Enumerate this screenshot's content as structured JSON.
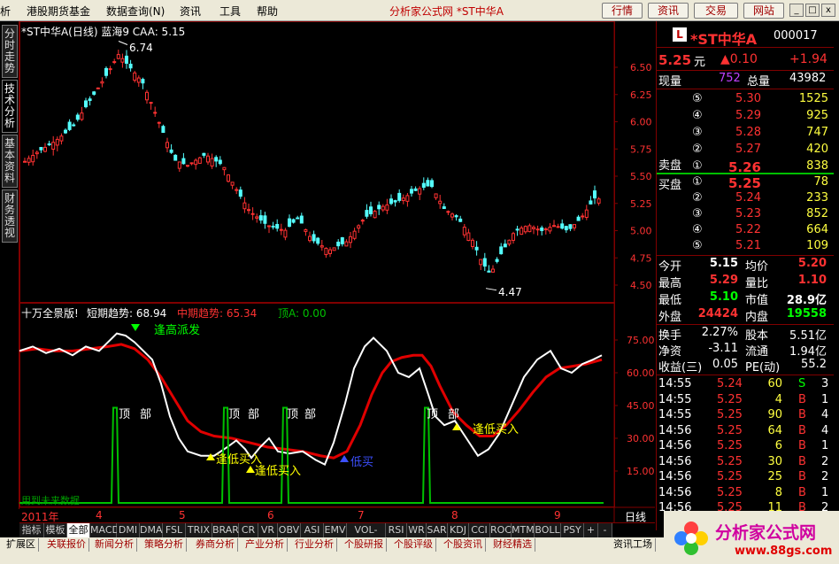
{
  "menu": {
    "items": [
      "析",
      "港股期货基金",
      "数据查询(N)",
      "资讯",
      "工具",
      "帮助"
    ],
    "center_title": "分析家公式网 *ST中华A",
    "right_buttons": [
      "行情",
      "资讯",
      "交易",
      "网站"
    ],
    "window_buttons": [
      "_",
      "□",
      "x"
    ]
  },
  "vtabs": [
    "分时走势",
    "技术分析",
    "基本资料",
    "财务透视"
  ],
  "main_chart": {
    "title": "*ST中华A(日线) 蓝海9 CAA: 5.15",
    "high_label": "6.74",
    "low_label": "4.47",
    "y_ticks": [
      "6.50",
      "6.25",
      "6.00",
      "5.75",
      "5.50",
      "5.25",
      "5.00",
      "4.75",
      "4.50"
    ]
  },
  "indicator": {
    "name": "十万全景版!",
    "short_label": "短期趋势: 68.94",
    "mid_label": "中期趋势: 65.34",
    "top_label": "顶A: 0.00",
    "y_ticks": [
      "75.00",
      "60.00",
      "45.00",
      "30.00",
      "15.00"
    ],
    "annotations": [
      "逢高派发",
      "逢低买入",
      "逢低买入",
      "低买",
      "逢低买入"
    ],
    "bottom_labels": [
      "顶",
      "部",
      "顶",
      "部",
      "顶",
      "部",
      "顶",
      "部"
    ],
    "footnote": "用到未来数据"
  },
  "time_axis": {
    "labels": [
      "2011年",
      "4",
      "5",
      "6",
      "7",
      "8",
      "9"
    ],
    "period": "日线"
  },
  "index_tabs": [
    "指标",
    "模板",
    "全部",
    "MACD",
    "DMI",
    "DMA",
    "FSL",
    "TRIX",
    "BRAR",
    "CR",
    "VR",
    "OBV",
    "ASI",
    "EMV",
    "VOL-TDX",
    "RSI",
    "WR",
    "SAR",
    "KDJ",
    "CCI",
    "ROC",
    "MTM",
    "BOLL",
    "PSY",
    "+",
    "-"
  ],
  "category_tabs": [
    "扩展区",
    "关联报价",
    "新闻分析",
    "策略分析",
    "券商分析",
    "产业分析",
    "行业分析",
    "个股研报",
    "个股评级",
    "个股资讯",
    "财经精选",
    "资讯工场"
  ],
  "quote": {
    "badge": "L",
    "name": "*ST中华A",
    "code": "000017",
    "price": "5.25",
    "price_unit": "元",
    "change": "▲0.10",
    "change_pct": "+1.94",
    "now_vol_label": "现量",
    "now_vol": "752",
    "total_vol_label": "总量",
    "total_vol": "43982",
    "sell_label": "卖盘",
    "buy_label": "买盘",
    "sells": [
      {
        "n": "⑤",
        "p": "5.30",
        "v": "1525"
      },
      {
        "n": "④",
        "p": "5.29",
        "v": "925"
      },
      {
        "n": "③",
        "p": "5.28",
        "v": "747"
      },
      {
        "n": "②",
        "p": "5.27",
        "v": "420"
      },
      {
        "n": "①",
        "p": "5.26",
        "v": "838"
      }
    ],
    "buys": [
      {
        "n": "①",
        "p": "5.25",
        "v": "78"
      },
      {
        "n": "②",
        "p": "5.24",
        "v": "233"
      },
      {
        "n": "③",
        "p": "5.23",
        "v": "852"
      },
      {
        "n": "④",
        "p": "5.22",
        "v": "664"
      },
      {
        "n": "⑤",
        "p": "5.21",
        "v": "109"
      }
    ],
    "stats": [
      {
        "l1": "今开",
        "v1": "5.15",
        "l2": "均价",
        "v2": "5.20"
      },
      {
        "l1": "最高",
        "v1": "5.29",
        "l2": "量比",
        "v2": "1.10"
      },
      {
        "l1": "最低",
        "v1": "5.10",
        "l2": "市值",
        "v2": "28.9亿"
      },
      {
        "l1": "外盘",
        "v1": "24424",
        "l2": "内盘",
        "v2": "19558"
      }
    ],
    "stats2": [
      {
        "l1": "换手",
        "v1": "2.27%",
        "l2": "股本",
        "v2": "5.51亿"
      },
      {
        "l1": "净资",
        "v1": "-3.11",
        "l2": "流通",
        "v2": "1.94亿"
      },
      {
        "l1": "收益(三)",
        "v1": "0.05",
        "l2": "PE(动)",
        "v2": "55.2"
      }
    ],
    "ticks": [
      {
        "t": "14:55",
        "p": "5.24",
        "v": "60",
        "s": "S",
        "n": "3"
      },
      {
        "t": "14:55",
        "p": "5.25",
        "v": "4",
        "s": "B",
        "n": "1"
      },
      {
        "t": "14:55",
        "p": "5.25",
        "v": "90",
        "s": "B",
        "n": "4"
      },
      {
        "t": "14:56",
        "p": "5.25",
        "v": "64",
        "s": "B",
        "n": "4"
      },
      {
        "t": "14:56",
        "p": "5.25",
        "v": "6",
        "s": "B",
        "n": "1"
      },
      {
        "t": "14:56",
        "p": "5.25",
        "v": "30",
        "s": "B",
        "n": "2"
      },
      {
        "t": "14:56",
        "p": "5.25",
        "v": "25",
        "s": "B",
        "n": "2"
      },
      {
        "t": "14:56",
        "p": "5.25",
        "v": "8",
        "s": "B",
        "n": "1"
      },
      {
        "t": "14:56",
        "p": "5.25",
        "v": "11",
        "s": "B",
        "n": "2"
      }
    ]
  },
  "logo": {
    "name": "分析家公式网",
    "url": "www.88gs.com"
  },
  "colors": {
    "up": "#ff3232",
    "down": "#54ffff",
    "short": "#ffffff",
    "mid": "#e00000",
    "top": "#00c000",
    "frame": "#800000"
  }
}
